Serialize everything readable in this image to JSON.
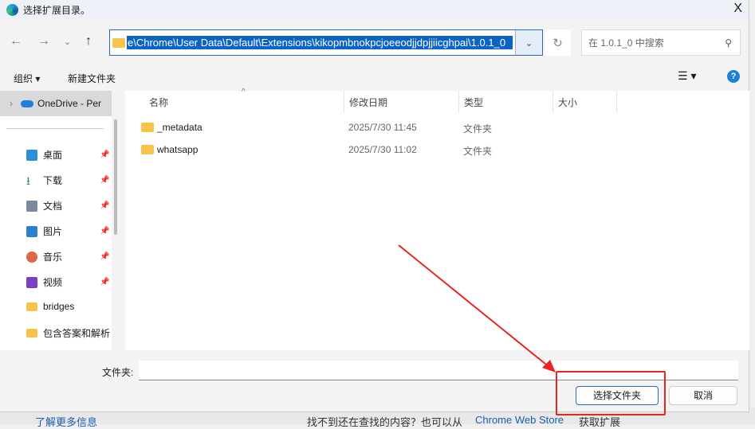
{
  "window": {
    "title": "选择扩展目录。",
    "close": "X"
  },
  "address": {
    "path": "e\\Chrome\\User Data\\Default\\Extensions\\kikopmbnokpcjoeeodjjdpjjiicghpai\\1.0.1_0"
  },
  "search": {
    "placeholder": "在 1.0.1_0 中搜索"
  },
  "toolbar": {
    "organize": "组织 ▾",
    "new_folder": "新建文件夹",
    "help": "?"
  },
  "sidebar": {
    "onedrive": "OneDrive - Per",
    "items": [
      {
        "label": "桌面",
        "color": "#2d8fd5"
      },
      {
        "label": "下载",
        "color": "#1a9a5c"
      },
      {
        "label": "文档",
        "color": "#7a8aa0"
      },
      {
        "label": "图片",
        "color": "#2f7fd0"
      },
      {
        "label": "音乐",
        "color": "#e0664a"
      },
      {
        "label": "视频",
        "color": "#7b3fc4"
      },
      {
        "label": "bridges",
        "color": "#f7c449"
      },
      {
        "label": "包含答案和解析",
        "color": "#f7c449"
      }
    ]
  },
  "columns": {
    "name": "名称",
    "date": "修改日期",
    "type": "类型",
    "size": "大小"
  },
  "files": [
    {
      "name": "_metadata",
      "date": "2025/7/30 11:45",
      "type": "文件夹"
    },
    {
      "name": "whatsapp",
      "date": "2025/7/30 11:02",
      "type": "文件夹"
    }
  ],
  "footer": {
    "folder_label": "文件夹:",
    "folder_value": "",
    "select": "选择文件夹",
    "cancel": "取消"
  },
  "background": {
    "text": "找不到还在查找的内容？也可以从",
    "link": "Chrome Web Store",
    "tail": "获取扩展",
    "left": "了解更多信息"
  },
  "annotation_color": "#e8251f"
}
